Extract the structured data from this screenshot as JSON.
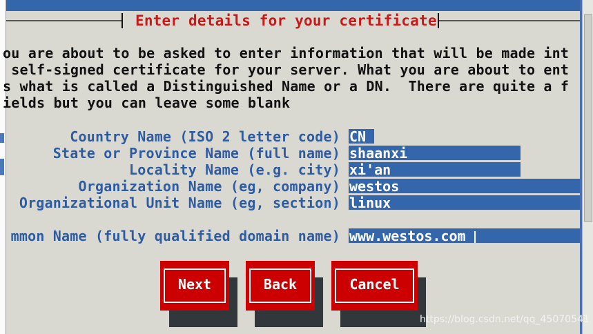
{
  "dialog": {
    "title": "Enter details for your certificate",
    "intro_lines": [
      "ou are about to be asked to enter information that will be made int",
      " self-signed certificate for your server. What you are about to ent",
      "s what is called a Distinguished Name or a DN.  There are quite a f",
      "ields but you can leave some blank"
    ]
  },
  "fields": [
    {
      "label": "Country Name (ISO 2 letter code)",
      "value": "CN"
    },
    {
      "label": "State or Province Name (full name)",
      "value": "shaanxi"
    },
    {
      "label": "Locality Name (e.g. city)",
      "value": "xi'an"
    },
    {
      "label": "Organization Name (eg, company)",
      "value": "westos"
    },
    {
      "label": "Organizational Unit Name (eg, section)",
      "value": "linux"
    },
    {
      "label": "mmon Name (fully qualified domain name)",
      "value": "www.westos.com"
    }
  ],
  "buttons": {
    "next": "Next",
    "back": "Back",
    "cancel": "Cancel"
  },
  "watermark": "https://blog.csdn.net/qq_45070541",
  "colors": {
    "background": "#d9d9d2",
    "title": "#c81818",
    "label": "#2f5b9f",
    "field_bg": "#3366aa",
    "button": "#cc0000"
  }
}
